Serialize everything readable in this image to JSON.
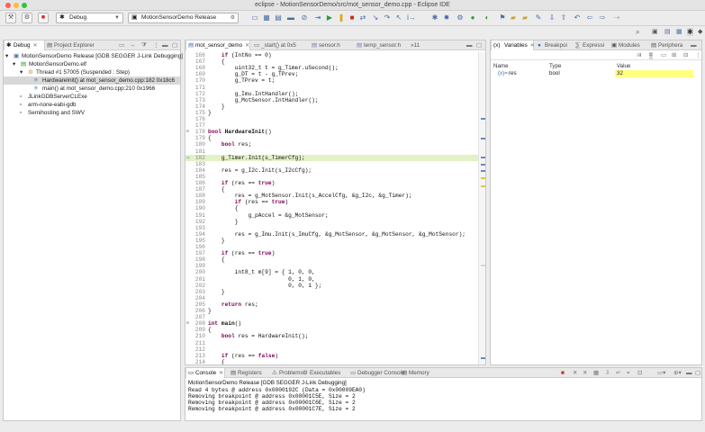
{
  "window": {
    "title": "eclipse - MotionSensorDemo/src/mot_sensor_demo.cpp - Eclipse IDE"
  },
  "toolbar": {
    "launch_mode": "Debug",
    "launch_config": "MotionSensorDemo Release"
  },
  "debug_view": {
    "tabs": [
      {
        "label": "Debug"
      },
      {
        "label": "Project Explorer"
      }
    ],
    "tree": [
      {
        "label": "MotionSensorDemo Release [GDB SEGGER J-Link Debugging]",
        "icon": "launch-icon"
      },
      {
        "label": "MotionSensorDemo.elf",
        "icon": "elf-icon"
      },
      {
        "label": "Thread #1 57005 (Suspended : Step)",
        "icon": "thread-icon"
      },
      {
        "label": "HardwareInit() at mot_sensor_demo.cpp:182 0x18c6",
        "icon": "stack-frame-icon"
      },
      {
        "label": "main() at mot_sensor_demo.cpp:210 0x1966",
        "icon": "stack-frame-icon"
      },
      {
        "label": "JLinkGDBServerCLExe",
        "icon": "process-icon"
      },
      {
        "label": "arm-none-eabi-gdb",
        "icon": "process-icon"
      },
      {
        "label": "Semihosting and SWV",
        "icon": "process-icon"
      }
    ]
  },
  "editor": {
    "tabs": [
      {
        "label": "mot_sensor_demo"
      },
      {
        "label": "_start() at 0x5"
      },
      {
        "label": "sensor.h"
      },
      {
        "label": "temp_sensor.h"
      },
      {
        "label": "»11"
      }
    ],
    "lines": [
      {
        "n": "166",
        "t": "    if (IntNo == 0)"
      },
      {
        "n": "167",
        "t": "    {"
      },
      {
        "n": "168",
        "t": "        uint32_t t = g_Timer.uSecond();"
      },
      {
        "n": "169",
        "t": "        g_DT = t - g_TPrev;"
      },
      {
        "n": "170",
        "t": "        g_TPrev = t;"
      },
      {
        "n": "171",
        "t": ""
      },
      {
        "n": "172",
        "t": "        g_Imu.IntHandler();"
      },
      {
        "n": "173",
        "t": "        g_MotSensor.IntHandler();"
      },
      {
        "n": "174",
        "t": "    }"
      },
      {
        "n": "175",
        "t": "}"
      },
      {
        "n": "176",
        "t": ""
      },
      {
        "n": "177",
        "t": ""
      },
      {
        "n": "178",
        "t": "bool HardwareInit()"
      },
      {
        "n": "179",
        "t": "{"
      },
      {
        "n": "180",
        "t": "    bool res;"
      },
      {
        "n": "181",
        "t": ""
      },
      {
        "n": "182",
        "t": "    g_Timer.Init(s_TimerCfg);"
      },
      {
        "n": "183",
        "t": ""
      },
      {
        "n": "184",
        "t": "    res = g_I2c.Init(s_I2cCfg);"
      },
      {
        "n": "185",
        "t": ""
      },
      {
        "n": "186",
        "t": "    if (res == true)"
      },
      {
        "n": "187",
        "t": "    {"
      },
      {
        "n": "188",
        "t": "        res = g_MotSensor.Init(s_AccelCfg, &g_I2c, &g_Timer);"
      },
      {
        "n": "189",
        "t": "        if (res == true)"
      },
      {
        "n": "190",
        "t": "        {"
      },
      {
        "n": "191",
        "t": "            g_pAccel = &g_MotSensor;"
      },
      {
        "n": "192",
        "t": "        }"
      },
      {
        "n": "193",
        "t": ""
      },
      {
        "n": "194",
        "t": "        res = g_Imu.Init(s_ImuCfg, &g_MotSensor, &g_MotSensor, &g_MotSensor);"
      },
      {
        "n": "195",
        "t": "    }"
      },
      {
        "n": "196",
        "t": ""
      },
      {
        "n": "197",
        "t": "    if (res == true)"
      },
      {
        "n": "198",
        "t": "    {"
      },
      {
        "n": "199",
        "t": ""
      },
      {
        "n": "200",
        "t": "        int8_t m[9] = { 1, 0, 0,"
      },
      {
        "n": "201",
        "t": "                        0, 1, 0,"
      },
      {
        "n": "202",
        "t": "                        0, 0, 1 };"
      },
      {
        "n": "203",
        "t": "    }"
      },
      {
        "n": "204",
        "t": ""
      },
      {
        "n": "205",
        "t": "    return res;"
      },
      {
        "n": "206",
        "t": "}"
      },
      {
        "n": "207",
        "t": ""
      },
      {
        "n": "208",
        "t": "int main()"
      },
      {
        "n": "209",
        "t": "{"
      },
      {
        "n": "210",
        "t": "    bool res = HardwareInit();"
      },
      {
        "n": "211",
        "t": ""
      },
      {
        "n": "212",
        "t": ""
      },
      {
        "n": "213",
        "t": "    if (res == false)"
      },
      {
        "n": "214",
        "t": "    {"
      }
    ],
    "current_line": "182"
  },
  "variables_view": {
    "tabs": [
      {
        "label": "Variables"
      },
      {
        "label": "Breakpoi"
      },
      {
        "label": "Expressi"
      },
      {
        "label": "Modules"
      },
      {
        "label": "Periphera"
      }
    ],
    "columns": {
      "name": "Name",
      "type": "Type",
      "value": "Value"
    },
    "rows": [
      {
        "name": "res",
        "type": "bool",
        "value": "32"
      }
    ]
  },
  "console_view": {
    "tabs": [
      {
        "label": "Console"
      },
      {
        "label": "Registers"
      },
      {
        "label": "Problems"
      },
      {
        "label": "Executables"
      },
      {
        "label": "Debugger Console"
      },
      {
        "label": "Memory"
      }
    ],
    "header": "MotionSensorDemo Release [GDB SEGGER J-Link Debugging]",
    "lines": [
      "Read 4 bytes @ address 0x0000192C (Data = 0x00009EA0)",
      "Removing breakpoint @ address 0x00001C5E, Size = 2",
      "Removing breakpoint @ address 0x00001C6E, Size = 2",
      "Removing breakpoint @ address 0x00001C7E, Size = 2"
    ]
  },
  "colors": {
    "current_line": "#e3f1c6",
    "keyword": "#7f0055",
    "value_highlight": "#ffff80"
  }
}
